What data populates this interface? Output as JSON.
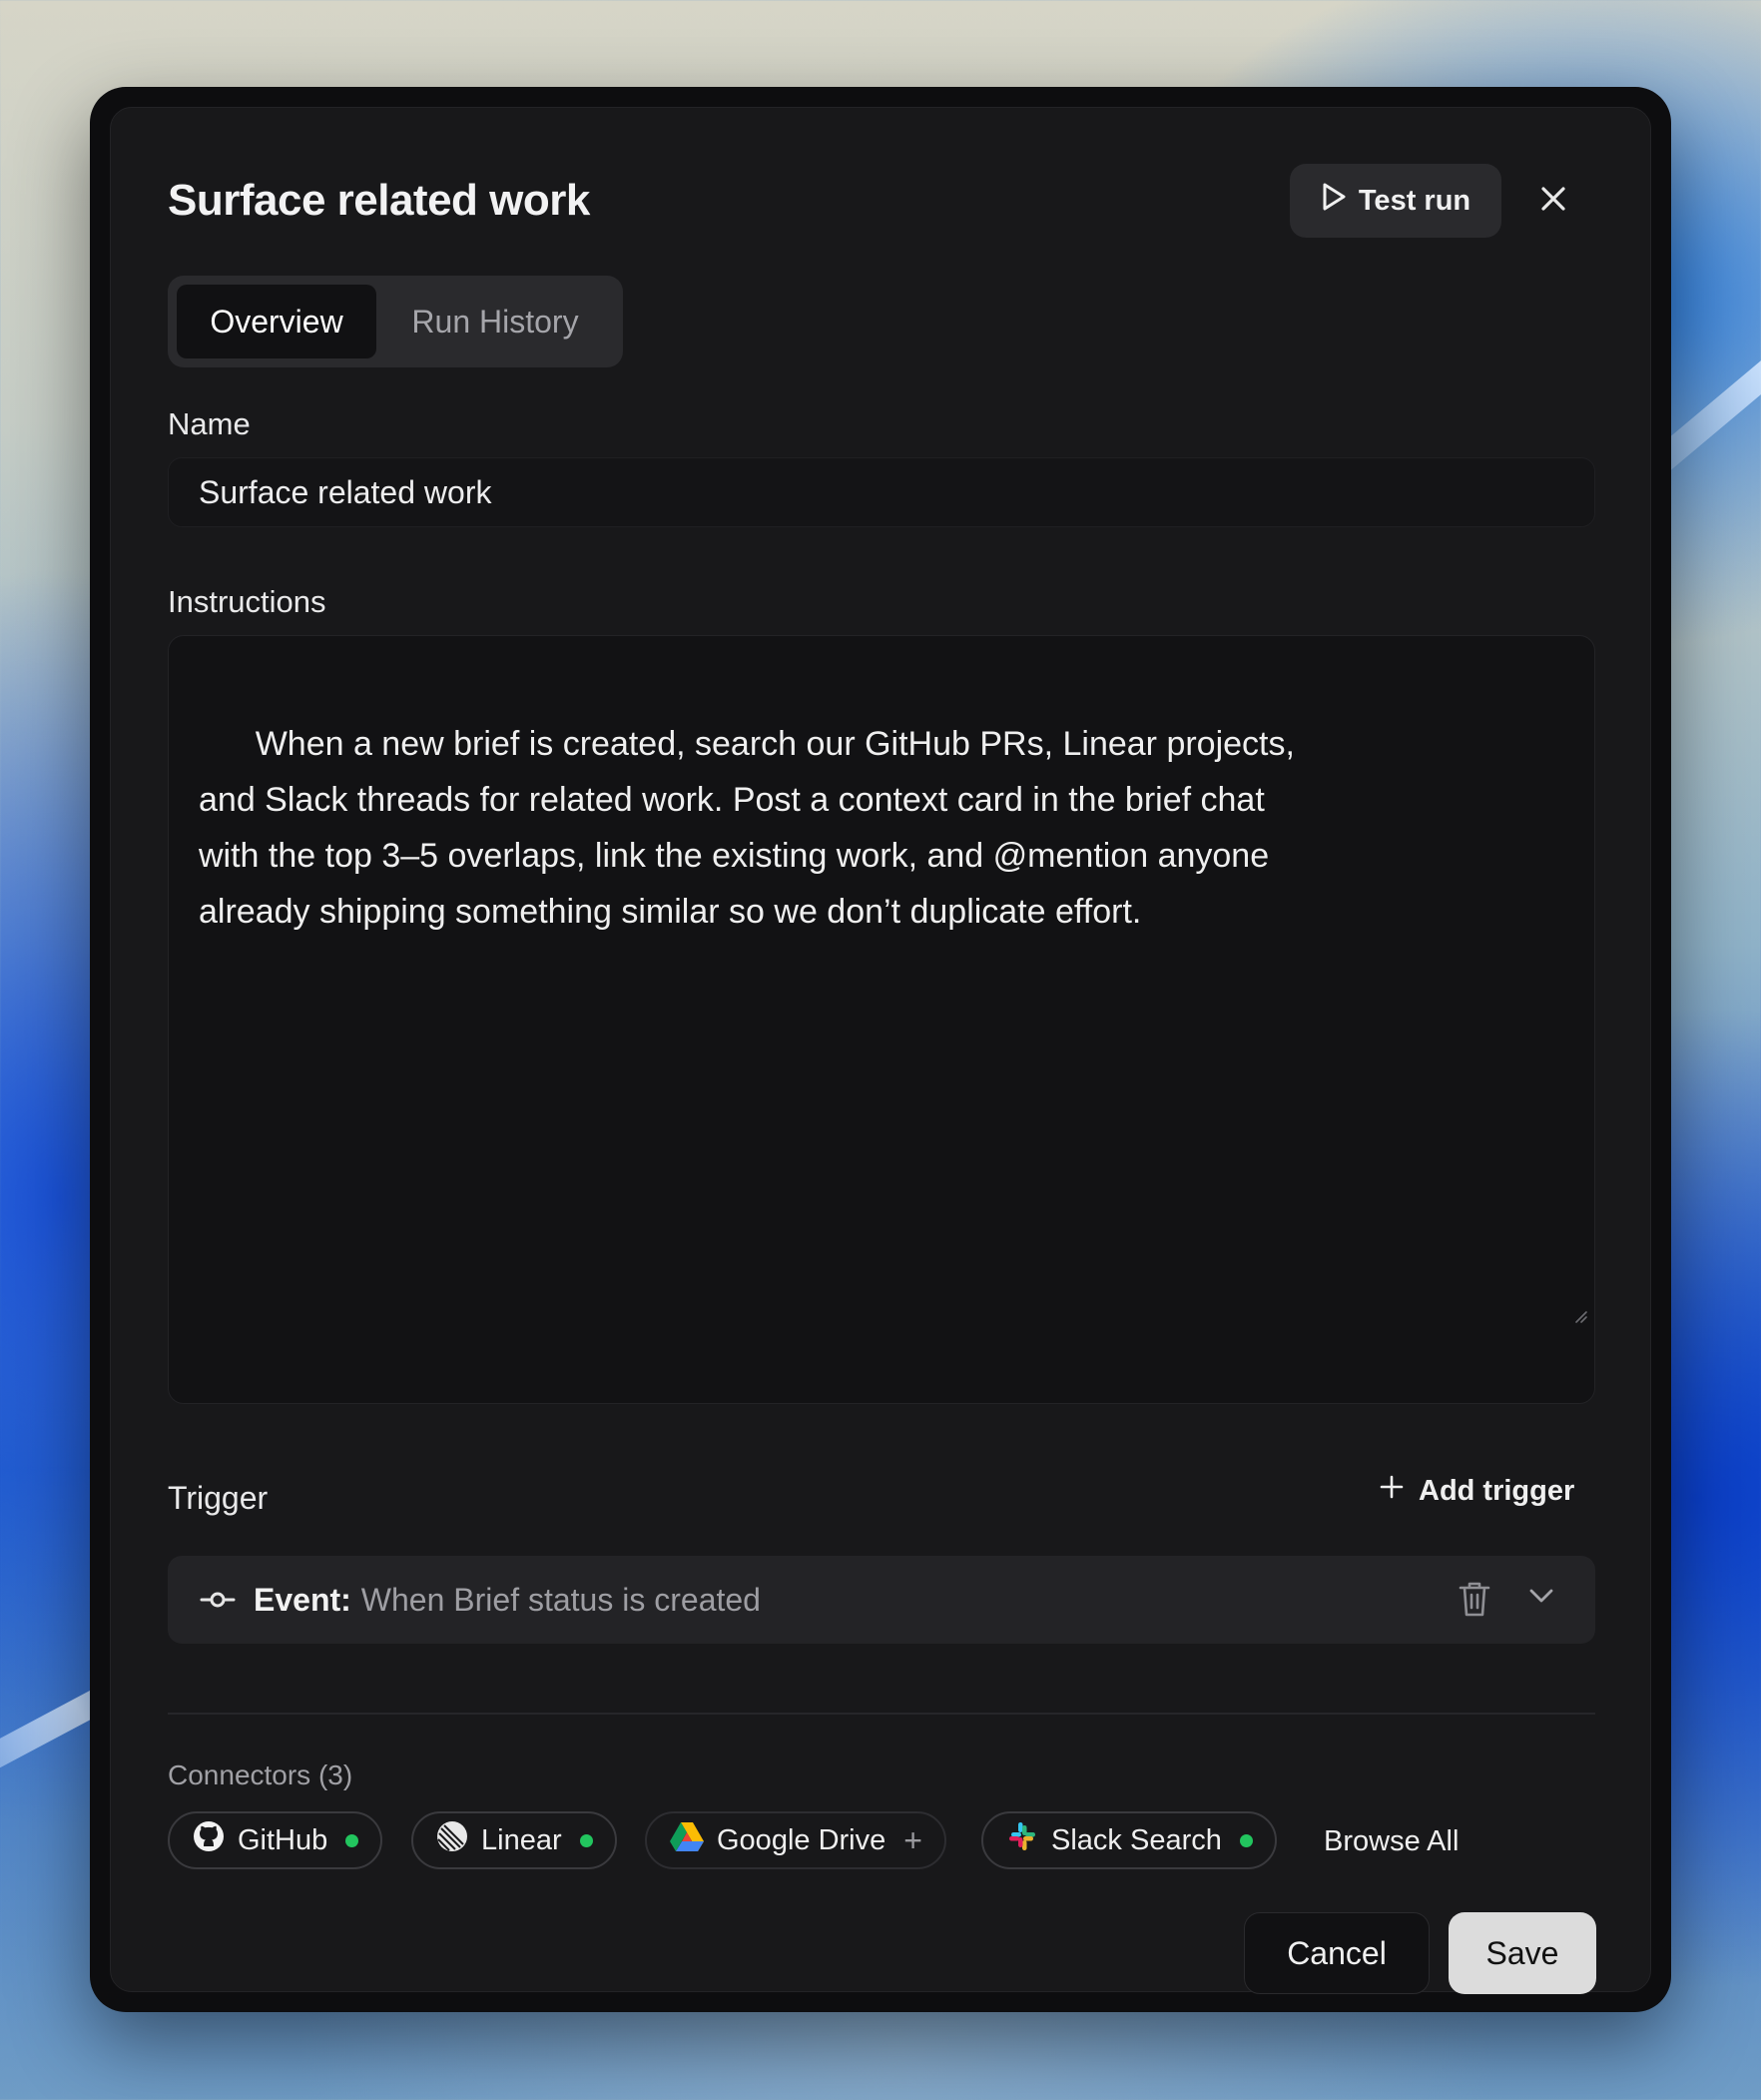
{
  "dialog": {
    "title": "Surface related work",
    "test_run_label": "Test run"
  },
  "tabs": [
    {
      "label": "Overview",
      "active": true
    },
    {
      "label": "Run History",
      "active": false
    }
  ],
  "form": {
    "name_label": "Name",
    "name_value": "Surface related work",
    "instructions_label": "Instructions",
    "instructions_value": "When a new brief is created, search our GitHub PRs, Linear projects,\nand Slack threads for related work. Post a context card in the brief chat\nwith the top 3–5 overlaps, link the existing work, and @mention anyone\nalready shipping something similar so we don’t duplicate effort."
  },
  "trigger": {
    "label": "Trigger",
    "add_label": "Add trigger",
    "event_key": "Event:",
    "event_value": "When Brief status is created"
  },
  "connectors": {
    "label": "Connectors (3)",
    "items": [
      {
        "name": "GitHub",
        "status": "connected",
        "icon": "github-icon"
      },
      {
        "name": "Linear",
        "status": "connected",
        "icon": "linear-icon"
      },
      {
        "name": "Google Drive",
        "status": "add",
        "icon": "google-drive-icon"
      },
      {
        "name": "Slack Search",
        "status": "connected",
        "icon": "slack-icon"
      }
    ],
    "browse_label": "Browse All"
  },
  "footer": {
    "cancel_label": "Cancel",
    "save_label": "Save"
  },
  "colors": {
    "panel_bg": "#18181a",
    "status_connected": "#22c55e",
    "save_bg": "#dcdcdc"
  }
}
